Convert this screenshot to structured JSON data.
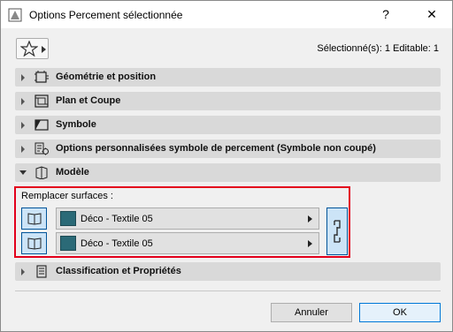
{
  "window": {
    "title": "Options Percement sélectionnée",
    "help_label": "?",
    "close_label": "✕"
  },
  "toolbar": {
    "favorites_icon": "star-icon",
    "selection_info": "Sélectionné(s): 1 Editable: 1"
  },
  "panels": [
    {
      "label": "Géométrie et position",
      "icon": "geometry-icon",
      "expanded": false
    },
    {
      "label": "Plan et Coupe",
      "icon": "floorplan-icon",
      "expanded": false
    },
    {
      "label": "Symbole",
      "icon": "symbol-icon",
      "expanded": false
    },
    {
      "label": "Options personnalisées symbole de percement (Symbole non coupé)",
      "icon": "custom-options-icon",
      "expanded": false
    },
    {
      "label": "Modèle",
      "icon": "model-icon",
      "expanded": true
    },
    {
      "label": "Classification et Propriétés",
      "icon": "classification-icon",
      "expanded": false
    }
  ],
  "model": {
    "override_label": "Remplacer surfaces :",
    "surfaces": [
      {
        "value": "Déco - Textile 05",
        "swatch_color": "#2b6a77"
      },
      {
        "value": "Déco - Textile 05",
        "swatch_color": "#2b6a77"
      }
    ]
  },
  "footer": {
    "cancel_label": "Annuler",
    "ok_label": "OK"
  },
  "colors": {
    "highlight_border": "#e3001b",
    "selected_button": "#cce4f7",
    "panel_header": "#d9d9d9"
  }
}
